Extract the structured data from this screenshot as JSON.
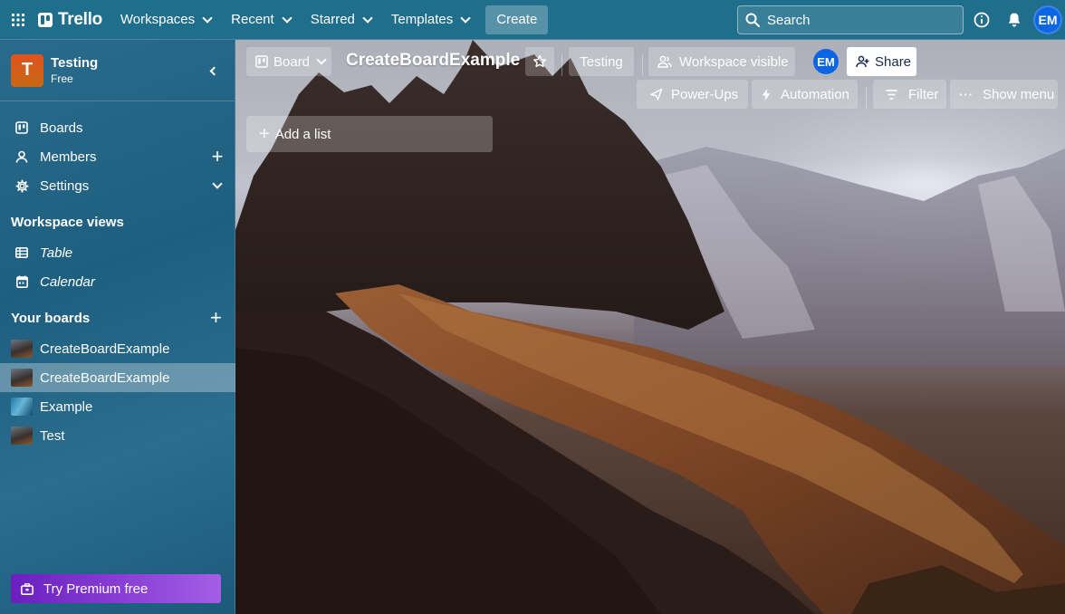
{
  "topbar": {
    "brand": "Trello",
    "nav": [
      {
        "label": "Workspaces"
      },
      {
        "label": "Recent"
      },
      {
        "label": "Starred"
      },
      {
        "label": "Templates"
      }
    ],
    "create_label": "Create",
    "search_placeholder": "Search",
    "avatar_initials": "EM"
  },
  "sidebar": {
    "workspace": {
      "initial": "T",
      "name": "Testing",
      "plan": "Free"
    },
    "items": [
      {
        "label": "Boards",
        "icon": "boards-icon"
      },
      {
        "label": "Members",
        "icon": "person-icon"
      },
      {
        "label": "Settings",
        "icon": "gear-icon"
      }
    ],
    "views_heading": "Workspace views",
    "views": [
      {
        "label": "Table",
        "icon": "table-icon"
      },
      {
        "label": "Calendar",
        "icon": "calendar-icon"
      }
    ],
    "boards_heading": "Your boards",
    "boards": [
      {
        "label": "CreateBoardExample",
        "thumb": "mountain"
      },
      {
        "label": "CreateBoardExample",
        "thumb": "mountain",
        "active": true
      },
      {
        "label": "Example",
        "thumb": "water"
      },
      {
        "label": "Test",
        "thumb": "mountain"
      }
    ],
    "premium_label": "Try Premium free"
  },
  "board": {
    "view_switch_label": "Board",
    "title": "CreateBoardExample",
    "workspace_label": "Testing",
    "visibility_label": "Workspace visible",
    "member_initials": "EM",
    "share_label": "Share",
    "powerups_label": "Power-Ups",
    "automation_label": "Automation",
    "filter_label": "Filter",
    "menu_label": "Show menu",
    "add_list_label": "Add a list"
  },
  "colors": {
    "topbar": "#1f6e8c",
    "accent_avatar": "#0c66e4",
    "premium_start": "#6a1fbf",
    "premium_end": "#a45ee5",
    "workspace_badge": "#e0521f"
  }
}
